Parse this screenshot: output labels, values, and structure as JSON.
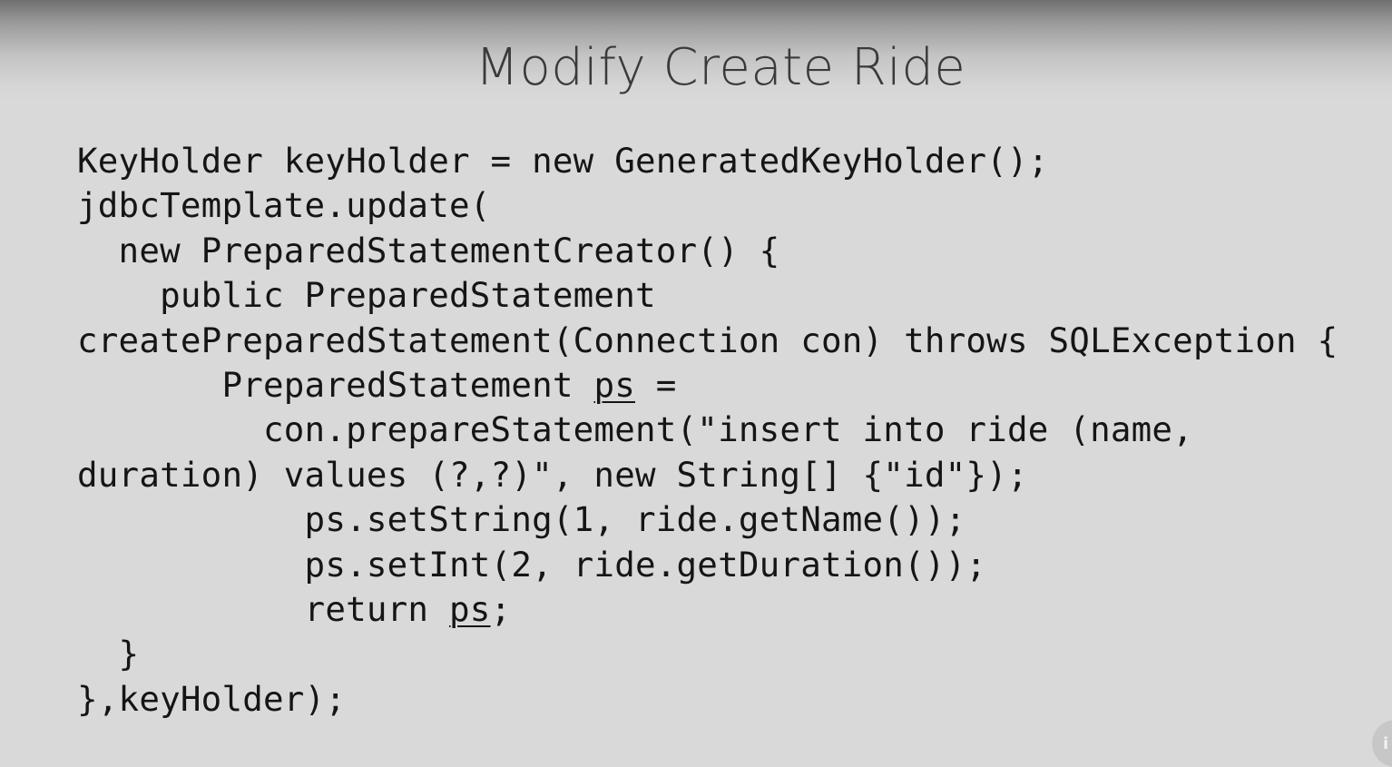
{
  "slide": {
    "title": "Modify Create Ride"
  },
  "code": {
    "lines": [
      {
        "segments": [
          "KeyHolder keyHolder = new GeneratedKeyHolder();"
        ]
      },
      {
        "segments": [
          "jdbcTemplate.update("
        ]
      },
      {
        "segments": [
          "  new PreparedStatementCreator() {"
        ]
      },
      {
        "segments": [
          "    public PreparedStatement"
        ]
      },
      {
        "segments": [
          "createPreparedStatement(Connection con) throws SQLException {"
        ]
      },
      {
        "segments": [
          "       PreparedStatement ",
          "ps",
          " ="
        ]
      },
      {
        "segments": [
          "         con.prepareStatement(\"insert into ride (name,"
        ]
      },
      {
        "segments": [
          "duration) values (?,?)\", new String[] {\"id\"});"
        ]
      },
      {
        "segments": [
          "           ps.setString(1, ride.getName());"
        ]
      },
      {
        "segments": [
          "           ps.setInt(2, ride.getDuration());"
        ]
      },
      {
        "segments": [
          "           return ",
          "ps",
          ";"
        ]
      },
      {
        "segments": [
          "  }"
        ]
      },
      {
        "segments": [
          "},keyHolder);"
        ]
      }
    ]
  },
  "badge": {
    "icon": "player-info-icon",
    "glyph": "i"
  }
}
